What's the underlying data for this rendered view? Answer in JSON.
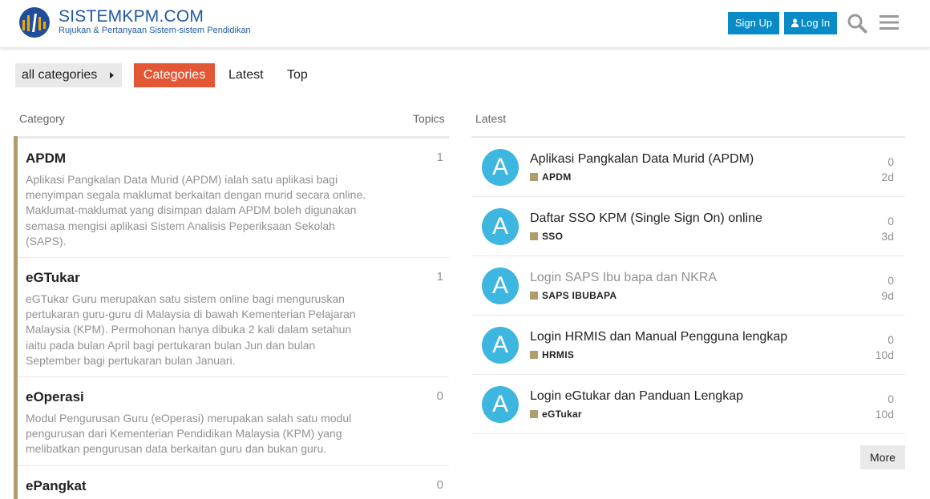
{
  "header": {
    "brand": "SISTEMKPM.COM",
    "tagline": "Rujukan & Pertanyaan Sistem-sistem Pendidikan",
    "signup_label": "Sign Up",
    "login_label": "Log In",
    "search_icon": "search-icon",
    "menu_icon": "hamburger-menu-icon",
    "accent_color": "#0a8bc8"
  },
  "nav": {
    "dropdown_label": "all categories",
    "tabs": [
      {
        "label": "Categories",
        "active": true
      },
      {
        "label": "Latest",
        "active": false
      },
      {
        "label": "Top",
        "active": false
      }
    ],
    "active_color": "#e45735"
  },
  "categories": {
    "col_category": "Category",
    "col_topics": "Topics",
    "items": [
      {
        "title": "APDM",
        "count": "1",
        "desc": "Aplikasi Pangkalan Data Murid (APDM) ialah satu aplikasi bagi menyimpan segala maklumat berkaitan dengan murid secara online. Maklumat-maklumat yang disimpan dalam APDM boleh digunakan semasa mengisi aplikasi Sistem Analisis Peperiksaan Sekolah (SAPS)."
      },
      {
        "title": "eGTukar",
        "count": "1",
        "desc": "eGTukar Guru merupakan satu sistem online bagi menguruskan pertukaran guru-guru di Malaysia di bawah Kementerian Pelajaran Malaysia (KPM). Permohonan hanya dibuka 2 kali dalam setahun iaitu pada bulan April bagi pertukaran bulan Jun dan bulan September bagi pertukaran bulan Januari."
      },
      {
        "title": "eOperasi",
        "count": "0",
        "desc": "Modul Pengurusan Guru (eOperasi) merupakan salah satu modul pengurusan dari Kementerian Pendidikan Malaysia (KPM) yang melibatkan pengurusan data berkaitan guru dan bukan guru."
      },
      {
        "title": "ePangkat",
        "count": "0",
        "desc": ""
      }
    ],
    "bar_color": "#b19c6b"
  },
  "latest": {
    "col_label": "Latest",
    "topics": [
      {
        "avatar": "A",
        "title": "Aplikasi Pangkalan Data Murid (APDM)",
        "category": "APDM",
        "replies": "0",
        "age": "2d",
        "visited": false
      },
      {
        "avatar": "A",
        "title": "Daftar SSO KPM (Single Sign On) online",
        "category": "SSO",
        "replies": "0",
        "age": "3d",
        "visited": false
      },
      {
        "avatar": "A",
        "title": "Login SAPS Ibu bapa dan NKRA",
        "category": "SAPS IBUBAPA",
        "replies": "0",
        "age": "9d",
        "visited": true
      },
      {
        "avatar": "A",
        "title": "Login HRMIS dan Manual Pengguna lengkap",
        "category": "HRMIS",
        "replies": "0",
        "age": "10d",
        "visited": false
      },
      {
        "avatar": "A",
        "title": "Login eGtukar dan Panduan Lengkap",
        "category": "eGTukar",
        "replies": "0",
        "age": "10d",
        "visited": false
      }
    ],
    "more_label": "More",
    "avatar_color": "#3db6e0"
  }
}
